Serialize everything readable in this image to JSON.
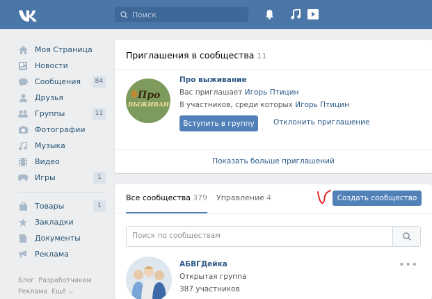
{
  "topbar": {
    "search_placeholder": "Поиск",
    "icons": [
      "vk-logo-icon",
      "search-icon",
      "bell-icon",
      "music-icon",
      "play-icon"
    ]
  },
  "leftnav": {
    "items": [
      {
        "label": "Моя Страница",
        "icon": "home-icon"
      },
      {
        "label": "Новости",
        "icon": "news-icon"
      },
      {
        "label": "Сообщения",
        "icon": "messages-icon",
        "badge": "84"
      },
      {
        "label": "Друзья",
        "icon": "friends-icon"
      },
      {
        "label": "Группы",
        "icon": "groups-icon",
        "badge": "11"
      },
      {
        "label": "Фотографии",
        "icon": "camera-icon"
      },
      {
        "label": "Музыка",
        "icon": "music-icon"
      },
      {
        "label": "Видео",
        "icon": "video-icon"
      },
      {
        "label": "Игры",
        "icon": "games-icon",
        "badge": "1"
      }
    ],
    "items2": [
      {
        "label": "Товары",
        "icon": "bag-icon",
        "badge": "1"
      },
      {
        "label": "Закладки",
        "icon": "star-icon"
      },
      {
        "label": "Документы",
        "icon": "document-icon"
      },
      {
        "label": "Реклама",
        "icon": "megaphone-icon"
      }
    ],
    "footer": {
      "blog": "Блог",
      "developers": "Разработчикам",
      "ads": "Реклама",
      "more": "Ещё ⌵"
    }
  },
  "invitations": {
    "title": "Приглашения в сообщества",
    "count": "11",
    "group": {
      "name": "Про выживание",
      "avatar_text_1": "Про",
      "avatar_text_2": "ВЫЖИВАНИЕ",
      "invited_prefix": "Вас приглашает",
      "inviter": "Игорь Птицин",
      "members_prefix": "8 участников, среди которых",
      "member_friend": "Игорь Птицин"
    },
    "join_button": "Вступить в группу",
    "decline_link": "Отклонить приглашение",
    "show_more": "Показать больше приглашений"
  },
  "communities": {
    "tabs": [
      {
        "label": "Все сообщества",
        "count": "379"
      },
      {
        "label": "Управление",
        "count": "4"
      }
    ],
    "create_button": "Создать сообщество",
    "search_placeholder": "Поиск по сообществам",
    "items": [
      {
        "title": "АБВГДейка",
        "type": "Открытая группа",
        "members": "387 участников"
      }
    ]
  },
  "colors": {
    "header": "#4a76a8",
    "accent_button": "#5181b8",
    "link": "#2a5885",
    "background": "#edeef0",
    "annotation_red": "#e02020"
  }
}
